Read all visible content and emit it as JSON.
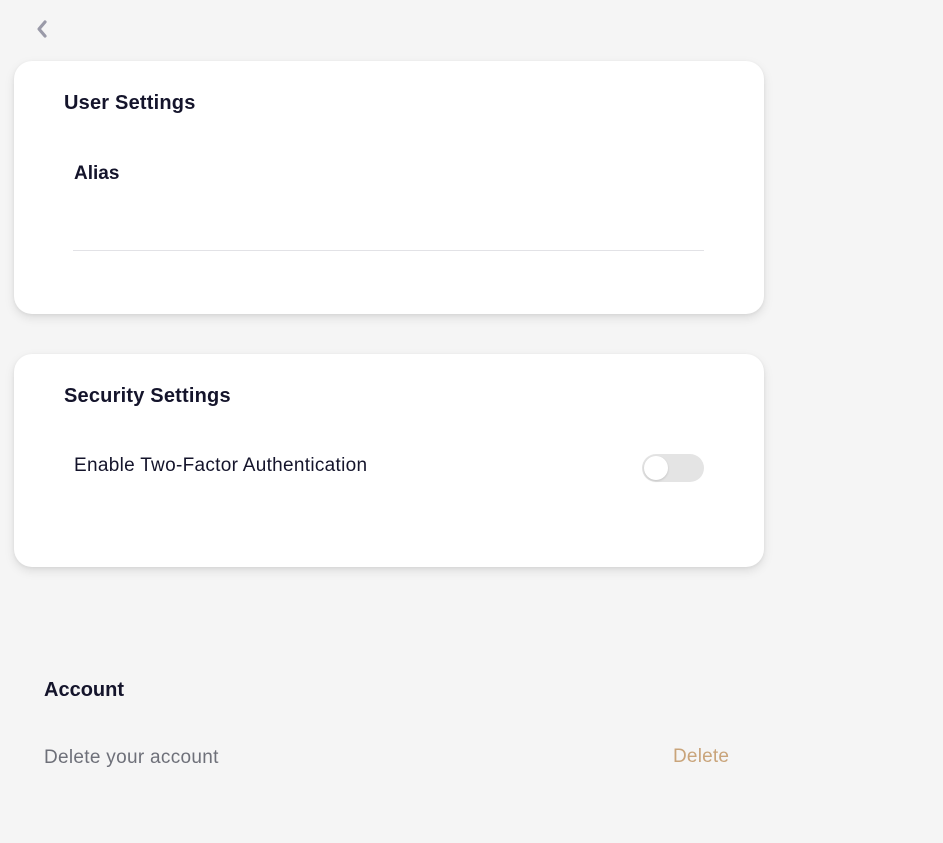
{
  "nav": {
    "back_icon": "chevron-left-icon"
  },
  "user_settings": {
    "title": "User Settings",
    "alias_label": "Alias",
    "alias_value": "",
    "alias_placeholder": ""
  },
  "security_settings": {
    "title": "Security Settings",
    "two_factor_label": "Enable Two-Factor Authentication",
    "two_factor_enabled": false
  },
  "account": {
    "title": "Account",
    "delete_description": "Delete your account",
    "delete_label": "Delete"
  },
  "colors": {
    "background": "#f5f5f5",
    "card": "#ffffff",
    "text_primary": "#14142b",
    "text_secondary": "#6e7079",
    "delete_accent": "#c9a47a",
    "toggle_off": "#e4e4e4",
    "icon": "#9a9aa8"
  }
}
